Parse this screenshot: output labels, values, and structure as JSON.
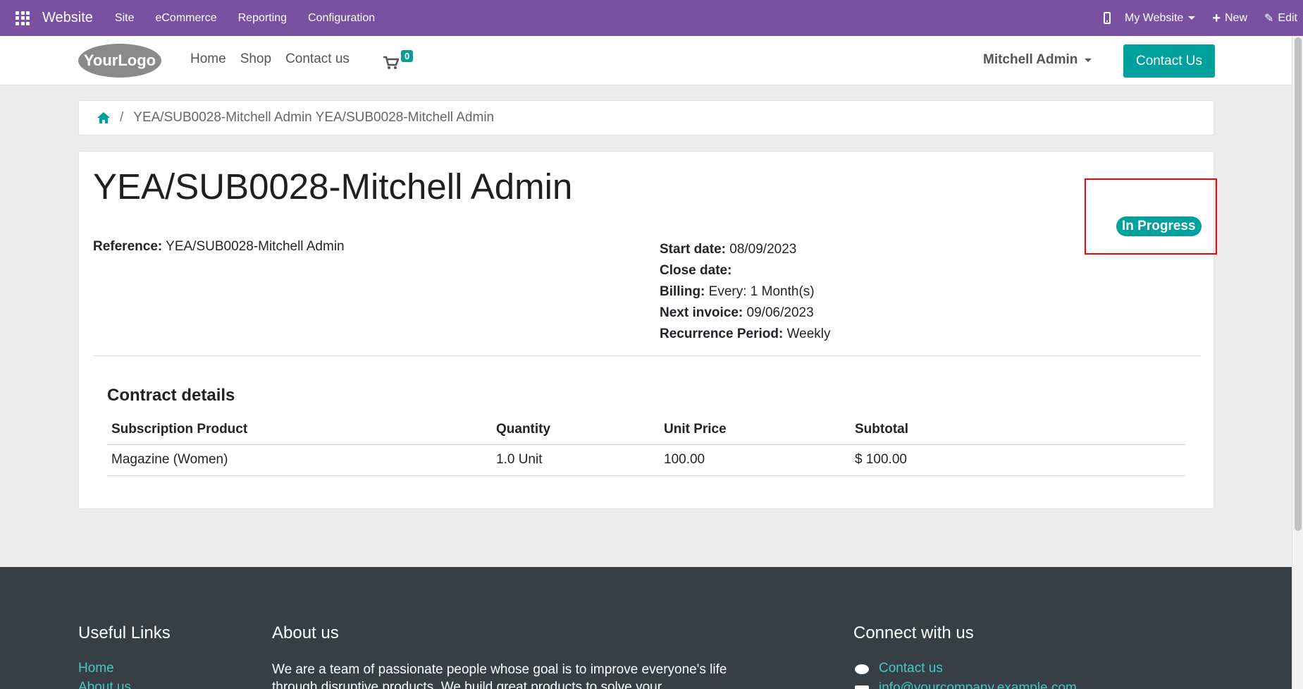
{
  "admin_bar": {
    "title": "Website",
    "menu": [
      "Site",
      "eCommerce",
      "Reporting",
      "Configuration"
    ],
    "website_selector": "My Website",
    "new_label": "New",
    "edit_label": "Edit",
    "color": "#7a51a0"
  },
  "header": {
    "logo_text": "YourLogo",
    "nav": [
      "Home",
      "Shop",
      "Contact us"
    ],
    "cart_count": "0",
    "user": "Mitchell Admin",
    "contact_button": "Contact Us",
    "accent": "#00a09d"
  },
  "breadcrumb": {
    "separator": "/",
    "current": "YEA/SUB0028-Mitchell Admin YEA/SUB0028-Mitchell Admin"
  },
  "subscription": {
    "title": "YEA/SUB0028-Mitchell Admin",
    "status": "In Progress",
    "reference_label": "Reference:",
    "reference": "YEA/SUB0028-Mitchell Admin",
    "start_date_label": "Start date:",
    "start_date": "08/09/2023",
    "close_date_label": "Close date:",
    "close_date": "",
    "billing_label": "Billing:",
    "billing": "Every: 1 Month(s)",
    "next_invoice_label": "Next invoice:",
    "next_invoice": "09/06/2023",
    "recurrence_label": "Recurrence Period:",
    "recurrence": "Weekly"
  },
  "contract": {
    "title": "Contract details",
    "columns": [
      "Subscription Product",
      "Quantity",
      "Unit Price",
      "Subtotal"
    ],
    "rows": [
      {
        "product": "Magazine (Women)",
        "quantity": "1.0 Unit",
        "unit_price": "100.00",
        "subtotal": "$ 100.00"
      }
    ]
  },
  "footer": {
    "useful_links_title": "Useful Links",
    "useful_links": [
      "Home",
      "About us"
    ],
    "about_title": "About us",
    "about_text": "We are a team of passionate people whose goal is to improve everyone's life through disruptive products. We build great products to solve your",
    "connect_title": "Connect with us",
    "connect_contact": "Contact us",
    "connect_email": "info@yourcompany.example.com"
  }
}
